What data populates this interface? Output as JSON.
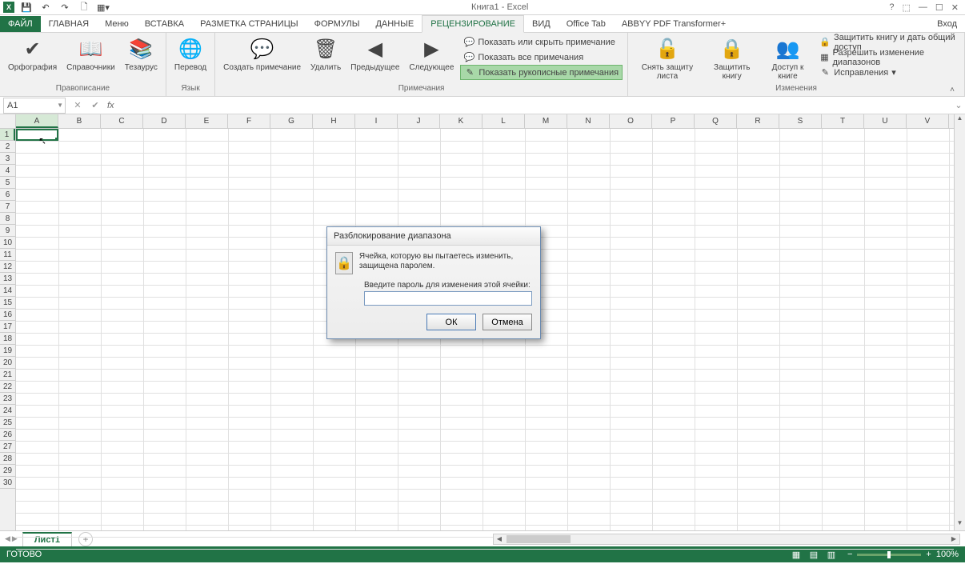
{
  "title": "Книга1 - Excel",
  "login": "Вход",
  "qat": [
    "save-icon",
    "undo-icon",
    "redo-icon",
    "new-icon",
    "customize-icon"
  ],
  "tabs": {
    "file": "ФАЙЛ",
    "items": [
      "ГЛАВНАЯ",
      "Меню",
      "ВСТАВКА",
      "РАЗМЕТКА СТРАНИЦЫ",
      "ФОРМУЛЫ",
      "ДАННЫЕ",
      "РЕЦЕНЗИРОВАНИЕ",
      "ВИД",
      "Office Tab",
      "ABBYY PDF Transformer+"
    ],
    "active": "РЕЦЕНЗИРОВАНИЕ"
  },
  "ribbon": {
    "groups": [
      {
        "label": "Правописание",
        "buttons": [
          {
            "name": "spelling-button",
            "label": "Орфография"
          },
          {
            "name": "research-button",
            "label": "Справочники"
          },
          {
            "name": "thesaurus-button",
            "label": "Тезаурус"
          }
        ]
      },
      {
        "label": "Язык",
        "buttons": [
          {
            "name": "translate-button",
            "label": "Перевод"
          }
        ]
      },
      {
        "label": "Примечания",
        "buttons": [
          {
            "name": "new-comment-button",
            "label": "Создать примечание"
          },
          {
            "name": "delete-comment-button",
            "label": "Удалить"
          },
          {
            "name": "prev-comment-button",
            "label": "Предыдущее"
          },
          {
            "name": "next-comment-button",
            "label": "Следующее"
          }
        ],
        "small": [
          {
            "name": "show-hide-comment",
            "label": "Показать или скрыть примечание"
          },
          {
            "name": "show-all-comments",
            "label": "Показать все примечания"
          },
          {
            "name": "show-ink",
            "label": "Показать рукописные примечания",
            "highlight": true
          }
        ]
      },
      {
        "label": "Изменения",
        "buttons": [
          {
            "name": "unprotect-sheet-button",
            "label": "Снять защиту листа"
          },
          {
            "name": "protect-workbook-button",
            "label": "Защитить книгу"
          },
          {
            "name": "share-workbook-button",
            "label": "Доступ к книге"
          }
        ],
        "small": [
          {
            "name": "protect-share",
            "label": "Защитить книгу и дать общий доступ"
          },
          {
            "name": "allow-edit-ranges",
            "label": "Разрешить изменение диапазонов"
          },
          {
            "name": "track-changes",
            "label": "Исправления",
            "dropdown": true
          }
        ]
      }
    ]
  },
  "name_box": "A1",
  "columns": [
    "A",
    "B",
    "C",
    "D",
    "E",
    "F",
    "G",
    "H",
    "I",
    "J",
    "K",
    "L",
    "M",
    "N",
    "O",
    "P",
    "Q",
    "R",
    "S",
    "T",
    "U",
    "V"
  ],
  "rows": [
    1,
    2,
    3,
    4,
    5,
    6,
    7,
    8,
    9,
    10,
    11,
    12,
    13,
    14,
    15,
    16,
    17,
    18,
    19,
    20,
    21,
    22,
    23,
    24,
    25,
    26,
    27,
    28,
    29,
    30
  ],
  "sheet": "Лист1",
  "status": "ГОТОВО",
  "zoom": "100%",
  "dialog": {
    "title": "Разблокирование диапазона",
    "msg1": "Ячейка, которую вы пытаетесь изменить, защищена паролем.",
    "prompt": "Введите пароль для изменения этой ячейки:",
    "ok": "ОК",
    "cancel": "Отмена"
  }
}
